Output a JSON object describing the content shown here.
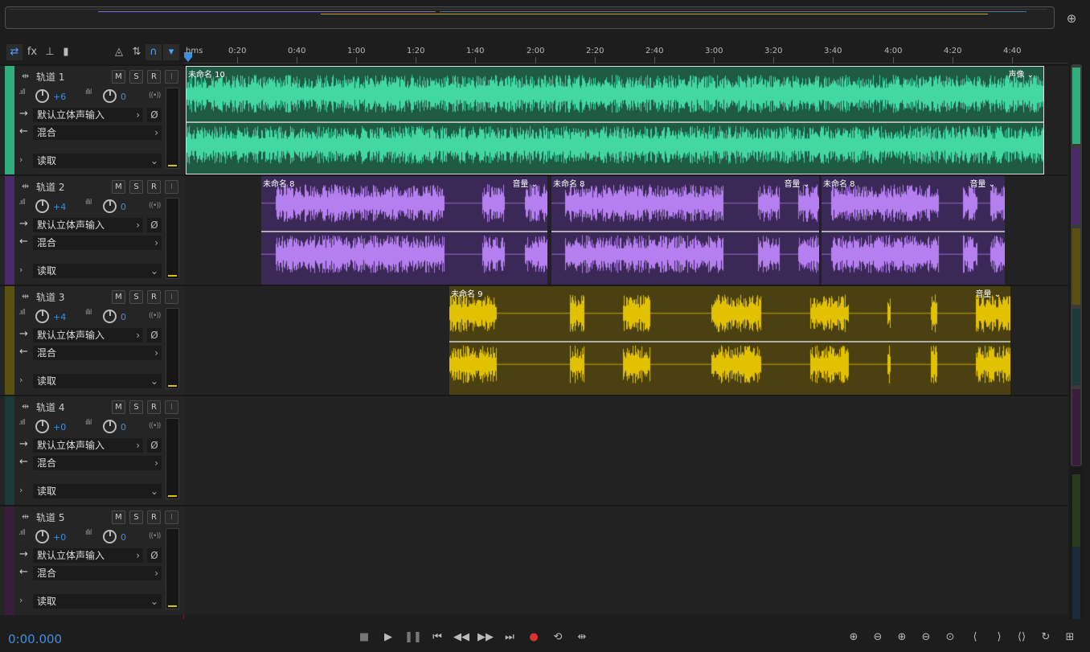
{
  "overview": {
    "zoom_icon": "zoom-fit-icon"
  },
  "toolbar": {
    "items": [
      {
        "name": "swap-view-icon",
        "glyph": "⇄",
        "active": true
      },
      {
        "name": "fx-icon",
        "glyph": "fx",
        "active": false
      },
      {
        "name": "sends-icon",
        "glyph": "⊥",
        "active": false
      },
      {
        "name": "eq-bars-icon",
        "glyph": "▮",
        "active": false
      },
      {
        "name": "metronome-icon",
        "glyph": "◬",
        "active": false
      },
      {
        "name": "loop-record-icon",
        "glyph": "⇅",
        "active": false
      },
      {
        "name": "headphone-icon",
        "glyph": "∩",
        "active": true
      },
      {
        "name": "marker-icon",
        "glyph": "▾",
        "active": true
      }
    ]
  },
  "ruler": {
    "labels": [
      "hms",
      "0:20",
      "0:40",
      "1:00",
      "1:20",
      "1:40",
      "2:00",
      "2:20",
      "2:40",
      "3:00",
      "3:20",
      "3:40",
      "4:00",
      "4:20",
      "4:40"
    ]
  },
  "tracks": [
    {
      "name": "轨道 1",
      "volume": "+6",
      "pan": "0",
      "input": "默认立体声输入",
      "output": "混合",
      "automation": "读取",
      "color": "#2fae7e",
      "m": "M",
      "s": "S",
      "r": "R",
      "i": "I"
    },
    {
      "name": "轨道 2",
      "volume": "+4",
      "pan": "0",
      "input": "默认立体声输入",
      "output": "混合",
      "automation": "读取",
      "color": "#4a2a6a",
      "m": "M",
      "s": "S",
      "r": "R",
      "i": "I"
    },
    {
      "name": "轨道 3",
      "volume": "+4",
      "pan": "0",
      "input": "默认立体声输入",
      "output": "混合",
      "automation": "读取",
      "color": "#5a5012",
      "m": "M",
      "s": "S",
      "r": "R",
      "i": "I"
    },
    {
      "name": "轨道 4",
      "volume": "+0",
      "pan": "0",
      "input": "默认立体声输入",
      "output": "混合",
      "automation": "读取",
      "color": "#1d3a3a",
      "m": "M",
      "s": "S",
      "r": "R",
      "i": "I"
    },
    {
      "name": "轨道 5",
      "volume": "+0",
      "pan": "0",
      "input": "默认立体声输入",
      "output": "混合",
      "automation": "读取",
      "color": "#3a1d3a",
      "m": "M",
      "s": "S",
      "r": "R",
      "i": "I"
    }
  ],
  "clips": {
    "track1": [
      {
        "title": "未命名 10",
        "menu": "声像 ⌄",
        "color": "#1e5a44",
        "wave": "#43d7a4"
      }
    ],
    "track2": [
      {
        "title": "未命名 8",
        "menu": "音量 ⌄",
        "color": "#3a2856",
        "wave": "#b57ff0"
      },
      {
        "title": "未命名 8",
        "menu": "音量 ⌄",
        "color": "#3a2856",
        "wave": "#b57ff0"
      },
      {
        "title": "未命名 8",
        "menu": "音量 ⌄",
        "color": "#3a2856",
        "wave": "#b57ff0"
      }
    ],
    "track3": [
      {
        "title": "未命名 9",
        "menu": "音量 ⌄",
        "color": "#4a4011",
        "wave": "#e2c100"
      }
    ]
  },
  "transport": {
    "timecode": "0:00.000",
    "buttons": [
      {
        "name": "stop-icon",
        "glyph": "■"
      },
      {
        "name": "play-icon",
        "glyph": "▶"
      },
      {
        "name": "pause-icon",
        "glyph": "❚❚"
      },
      {
        "name": "go-to-start-icon",
        "glyph": "⏮"
      },
      {
        "name": "rewind-icon",
        "glyph": "◀◀"
      },
      {
        "name": "fast-forward-icon",
        "glyph": "▶▶"
      },
      {
        "name": "go-to-end-icon",
        "glyph": "⏭"
      },
      {
        "name": "record-icon",
        "glyph": "●"
      },
      {
        "name": "loop-icon",
        "glyph": "⟲"
      },
      {
        "name": "skip-selection-icon",
        "glyph": "⇹"
      }
    ],
    "zoom": [
      {
        "name": "zoom-in-amplitude-icon",
        "glyph": "⊕"
      },
      {
        "name": "zoom-out-amplitude-icon",
        "glyph": "⊖"
      },
      {
        "name": "zoom-in-time-icon",
        "glyph": "⊕"
      },
      {
        "name": "zoom-out-time-icon",
        "glyph": "⊖"
      },
      {
        "name": "zoom-full-icon",
        "glyph": "⊙"
      },
      {
        "name": "zoom-in-left-icon",
        "glyph": "⟨"
      },
      {
        "name": "zoom-in-right-icon",
        "glyph": "⟩"
      },
      {
        "name": "zoom-selection-icon",
        "glyph": "⟨⟩"
      },
      {
        "name": "zoom-reset-icon",
        "glyph": "↻"
      },
      {
        "name": "zoom-tracks-icon",
        "glyph": "⊞"
      }
    ]
  }
}
